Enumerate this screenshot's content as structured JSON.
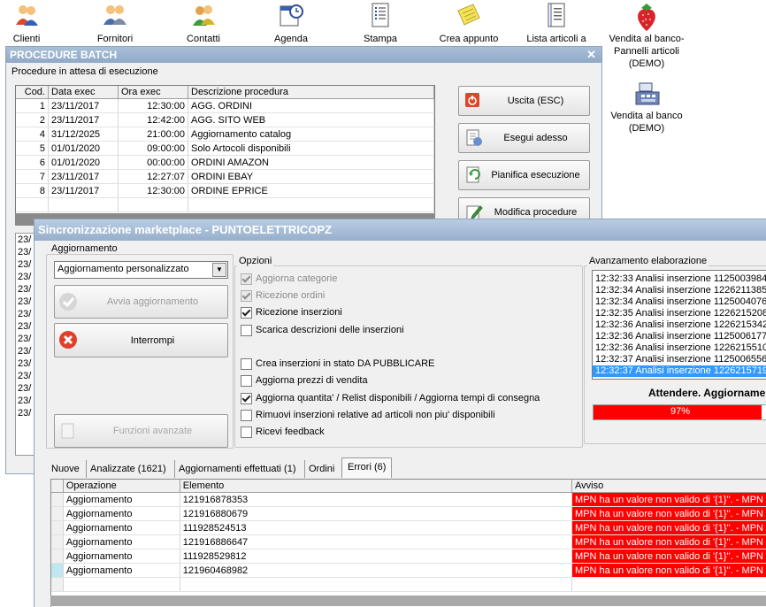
{
  "toolbar": {
    "items": [
      {
        "label": "Clienti",
        "icon": "clients-icon"
      },
      {
        "label": "Fornitori",
        "icon": "suppliers-icon"
      },
      {
        "label": "Contatti",
        "icon": "contacts-icon"
      },
      {
        "label": "Agenda",
        "icon": "agenda-icon"
      },
      {
        "label": "Stampa",
        "icon": "print-icon"
      },
      {
        "label": "Crea appunto",
        "icon": "note-icon"
      },
      {
        "label": "Lista articoli a",
        "icon": "list-icon"
      }
    ]
  },
  "desktop": {
    "pos1": "Vendita al banco-\nPannelli articoli\n(DEMO)",
    "pos2": "Vendita al banco\n(DEMO)"
  },
  "batch": {
    "title": "PROCEDURE BATCH",
    "subtitle": "Procedure in attesa di esecuzione",
    "columns": [
      "Cod.",
      "Data exec",
      "Ora exec",
      "Descrizione procedura"
    ],
    "rows": [
      [
        "1",
        "23/11/2017",
        "12:30:00",
        "AGG. ORDINI"
      ],
      [
        "2",
        "23/11/2017",
        "12:42:00",
        "AGG. SITO WEB"
      ],
      [
        "4",
        "31/12/2025",
        "21:00:00",
        "Aggiornamento catalog"
      ],
      [
        "5",
        "01/01/2020",
        "09:00:00",
        "Solo Artocoli disponibili"
      ],
      [
        "6",
        "01/01/2020",
        "00:00:00",
        "ORDINI AMAZON"
      ],
      [
        "7",
        "23/11/2017",
        "12:27:07",
        "ORDINI EBAY"
      ],
      [
        "8",
        "23/11/2017",
        "12:30:00",
        "ORDINE EPRICE"
      ]
    ],
    "buttons": {
      "exit": "Uscita (ESC)",
      "run": "Esegui adesso",
      "schedule": "Pianifica esecuzione",
      "edit": "Modifica procedure"
    },
    "left_partial": [
      "23/",
      "23/",
      "23/",
      "23/",
      "23/",
      "23/",
      "23/",
      "23/",
      "23/",
      "23/",
      "23/",
      "23/",
      "23/",
      "23/",
      "23/"
    ]
  },
  "sync": {
    "title": "Sincronizzazione marketplace - PUNTOELETTRICOPZ",
    "group_update": "Aggiornamento",
    "mode_select": "Aggiornamento personalizzato",
    "start_button": "Avvia aggiornamento",
    "stop_button": "Interrompi",
    "advanced_button": "Funzioni avanzate",
    "group_options": "Opzioni",
    "options": [
      {
        "label": "Aggiorna categorie",
        "checked": true,
        "disabled": true
      },
      {
        "label": "Ricezione ordini",
        "checked": true,
        "disabled": true
      },
      {
        "label": "Ricezione inserzioni",
        "checked": true,
        "disabled": false
      },
      {
        "label": "Scarica descrizioni delle inserzioni",
        "checked": false,
        "disabled": false
      },
      {
        "label": "Crea inserzioni in stato DA PUBBLICARE",
        "checked": false,
        "disabled": false
      },
      {
        "label": "Aggiorna prezzi di vendita",
        "checked": false,
        "disabled": false
      },
      {
        "label": "Aggiorna quantita' / Relist disponibili / Aggiorna tempi di consegna",
        "checked": true,
        "disabled": false
      },
      {
        "label": "Rimuovi inserzioni relative ad articoli non piu' disponibili",
        "checked": false,
        "disabled": false
      },
      {
        "label": "Ricevi feedback",
        "checked": false,
        "disabled": false
      }
    ],
    "group_progress": "Avanzamento elaborazione",
    "log": [
      "12:32:33 Analisi inserzione 1125003984",
      "12:32:34 Analisi inserzione 1226211385",
      "12:32:34 Analisi inserzione 1125004076",
      "12:32:35 Analisi inserzione 1226215208",
      "12:32:36 Analisi inserzione 1226215342",
      "12:32:36 Analisi inserzione 1125006177",
      "12:32:36 Analisi inserzione 1226215510",
      "12:32:37 Analisi inserzione 1125006556",
      "12:32:37 Analisi inserzione 1226215719"
    ],
    "status": "Attendere. Aggiorname",
    "progress_text": "97%",
    "progress": 0.97,
    "tabs": [
      "Nuove",
      "Analizzate (1621)",
      "Aggiornamenti effettuati (1)",
      "Ordini",
      "Errori (6)"
    ],
    "active_tab": 4,
    "err_columns": [
      "Operazione",
      "Elemento",
      "Avviso"
    ],
    "errors": [
      [
        "Aggiornamento",
        "121916878353",
        "MPN ha un valore non valido di '{1}''. - MPN"
      ],
      [
        "Aggiornamento",
        "121916880679",
        "MPN ha un valore non valido di '{1}''. - MPN"
      ],
      [
        "Aggiornamento",
        "111928524513",
        "MPN ha un valore non valido di '{1}''. - MPN"
      ],
      [
        "Aggiornamento",
        "121916886647",
        "MPN ha un valore non valido di '{1}''. - MPN"
      ],
      [
        "Aggiornamento",
        "111928529812",
        "MPN ha un valore non valido di '{1}''. - MPN"
      ],
      [
        "Aggiornamento",
        "121960468982",
        "MPN ha un valore non valido di '{1}''. - MPN"
      ]
    ]
  },
  "colors": {
    "title_blue": "#8fa9c7",
    "error_red": "#ff0000",
    "selection_blue": "#3399ff"
  }
}
